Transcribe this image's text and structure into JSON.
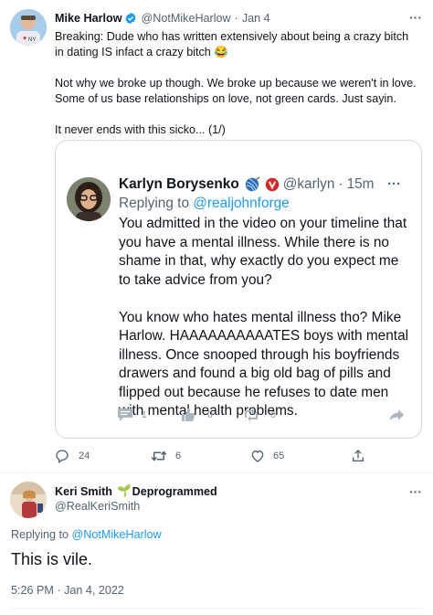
{
  "main_tweet": {
    "name": "Mike Harlow",
    "handle": "@NotMikeHarlow",
    "separator": "·",
    "date": "Jan 4",
    "text": "Breaking: Dude who has written extensively about being a crazy bitch in dating IS infact a crazy bitch 😂\n\nNot why we broke up though. We broke up because we weren't in love. Some of us base relationships on love, not green cards. Just sayin.\n\nIt never ends with this sicko... (1/)",
    "more": "···",
    "actions": {
      "replies": "24",
      "retweets": "6",
      "likes": "65"
    }
  },
  "quoted": {
    "name": "Karlyn Borysenko",
    "handle": "@karlyn",
    "separator": "·",
    "time": "15m",
    "replying_prefix": "Replying to",
    "replying_to": "@realjohnforge",
    "text": "You admitted in the video on your timeline that you have a mental illness. While there is no shame in that, why exactly do you expect me to take advice from you?\n\nYou know who hates mental illness tho? Mike Harlow. HAAAAAAAAAATES boys with mental illness. Once snooped through his boyfriends drawers and found a big old bag of pills and flipped out because he refuses to date men with mental health problems.",
    "more": "···",
    "actions": {
      "replies": "1",
      "likes": "0",
      "retweets": "0"
    }
  },
  "reply": {
    "name": "Keri Smith",
    "emoji": "🌱",
    "tag": "Deprogrammed",
    "handle": "@RealKeriSmith",
    "more": "···",
    "replying_prefix": "Replying to",
    "replying_to": "@NotMikeHarlow",
    "text": "This is vile.",
    "timestamp": "5:26 PM · Jan 4, 2022"
  },
  "colors": {
    "verified": "#1d9bf0",
    "link": "#1d9bf0",
    "muted": "#536471",
    "border": "#cfd9de"
  }
}
